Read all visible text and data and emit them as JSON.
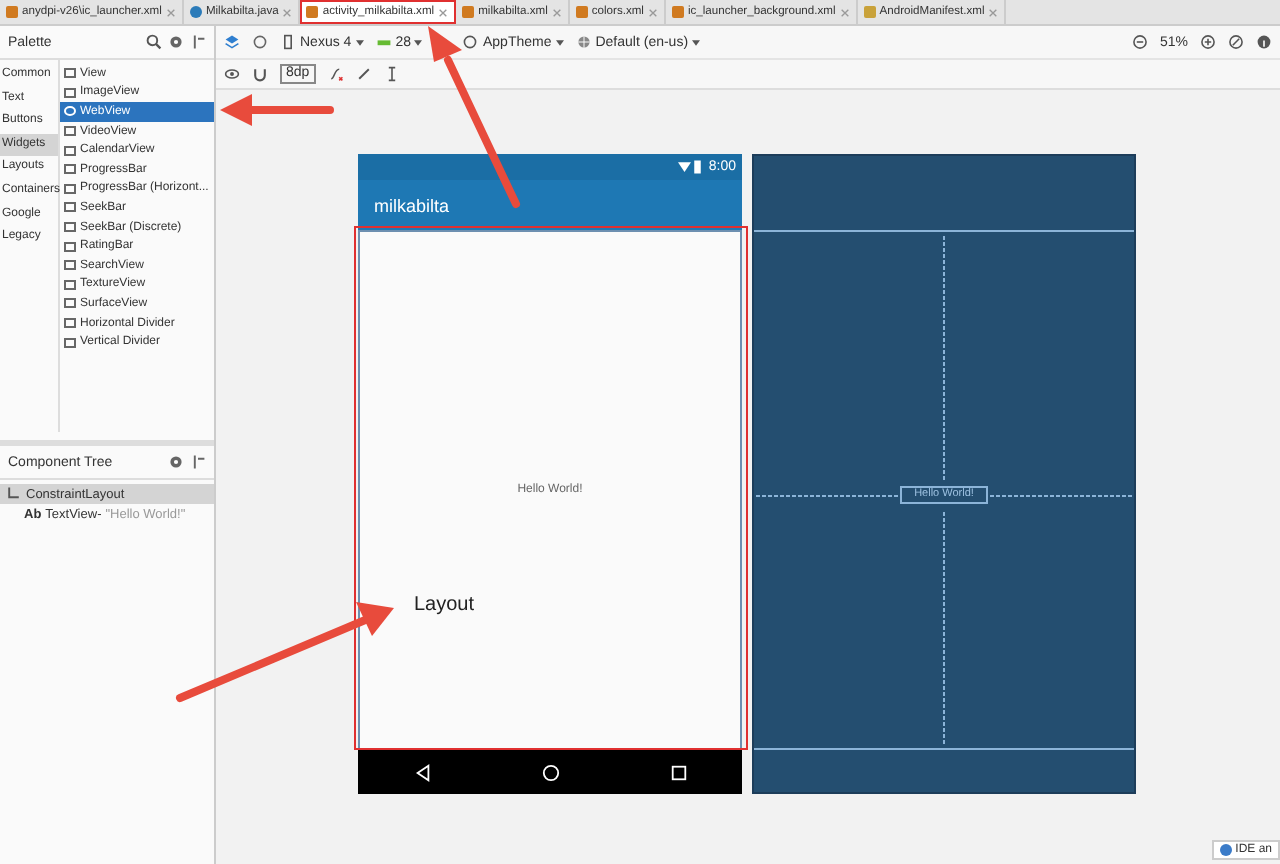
{
  "tabs": [
    {
      "label": "anydpi-v26\\ic_launcher.xml",
      "kind": "xml",
      "selected": false,
      "highlighted": false
    },
    {
      "label": "Milkabilta.java",
      "kind": "java",
      "selected": false,
      "highlighted": false
    },
    {
      "label": "activity_milkabilta.xml",
      "kind": "layout",
      "selected": true,
      "highlighted": true
    },
    {
      "label": "milkabilta.xml",
      "kind": "xml",
      "selected": false,
      "highlighted": false
    },
    {
      "label": "colors.xml",
      "kind": "xml",
      "selected": false,
      "highlighted": false
    },
    {
      "label": "ic_launcher_background.xml",
      "kind": "xml",
      "selected": false,
      "highlighted": false
    },
    {
      "label": "AndroidManifest.xml",
      "kind": "manifest",
      "selected": false,
      "highlighted": false
    }
  ],
  "palette": {
    "title": "Palette",
    "categories": [
      {
        "label": "Common",
        "selected": false
      },
      {
        "label": "Text",
        "selected": false
      },
      {
        "label": "Buttons",
        "selected": false
      },
      {
        "label": "Widgets",
        "selected": true
      },
      {
        "label": "Layouts",
        "selected": false
      },
      {
        "label": "Containers",
        "selected": false
      },
      {
        "label": "Google",
        "selected": false
      },
      {
        "label": "Legacy",
        "selected": false
      }
    ],
    "items": [
      {
        "label": "View",
        "selected": false
      },
      {
        "label": "ImageView",
        "selected": false
      },
      {
        "label": "WebView",
        "selected": true
      },
      {
        "label": "VideoView",
        "selected": false
      },
      {
        "label": "CalendarView",
        "selected": false
      },
      {
        "label": "ProgressBar",
        "selected": false
      },
      {
        "label": "ProgressBar (Horizont...",
        "selected": false
      },
      {
        "label": "SeekBar",
        "selected": false
      },
      {
        "label": "SeekBar (Discrete)",
        "selected": false
      },
      {
        "label": "RatingBar",
        "selected": false
      },
      {
        "label": "SearchView",
        "selected": false
      },
      {
        "label": "TextureView",
        "selected": false
      },
      {
        "label": "SurfaceView",
        "selected": false
      },
      {
        "label": "Horizontal Divider",
        "selected": false
      },
      {
        "label": "Vertical Divider",
        "selected": false
      }
    ]
  },
  "component_tree": {
    "title": "Component Tree",
    "nodes": [
      {
        "label": "ConstraintLayout",
        "selected": true,
        "children": [
          {
            "badge": "Ab",
            "label": "TextView-",
            "detail": "\"Hello World!\"",
            "selected": false
          }
        ]
      }
    ]
  },
  "toolbar": {
    "device": "Nexus 4",
    "api": "28",
    "theme": "AppTheme",
    "locale": "Default (en-us)",
    "margin": "8dp",
    "zoom": "51%"
  },
  "phone": {
    "time": "8:00",
    "app_title": "milkabilta",
    "text": "Hello World!"
  },
  "blueprint": {
    "text": "Hello World!"
  },
  "annotation": {
    "text": "Layout"
  },
  "notification": {
    "text": "IDE an"
  }
}
